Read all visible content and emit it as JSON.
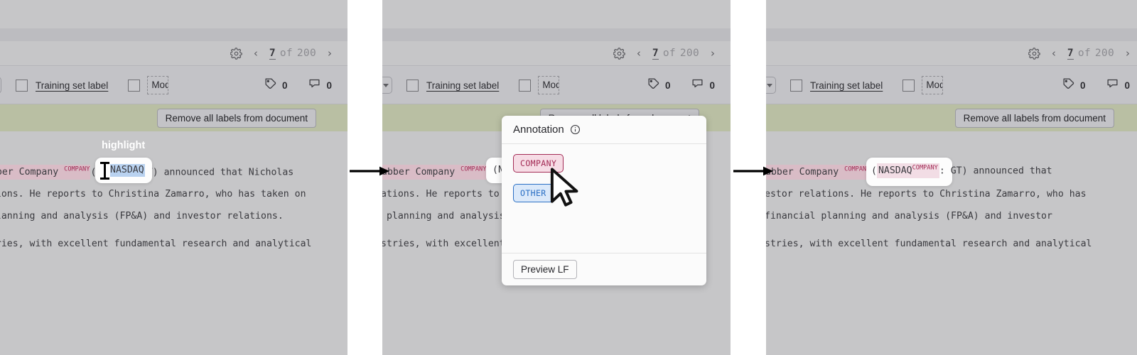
{
  "app": {
    "panel_count": 3
  },
  "toolbar": {
    "training_set_label": "Training set label",
    "mod_chip": "Mod",
    "tag_count": "0",
    "comment_count": "0",
    "gear_icon": "gear-icon",
    "tag_icon": "tag-icon",
    "comment_icon": "comment-icon",
    "chevron_icon": "chevron-down-icon"
  },
  "pager": {
    "prev": "‹",
    "next": "›",
    "current": "7",
    "of": "of",
    "total": "200"
  },
  "greenbar": {
    "remove_all_label": "Remove all labels from document"
  },
  "document": {
    "line1_pre": "ubber Company ",
    "line1_sup": "COMPANY",
    "line1_mid_p1": "(",
    "line1_nasdaq": "NASDAQ",
    "line1_post_p1": ": GT) announced that Nicholas",
    "line2_p1": "ations. He reports to Christina Zamarro, who has taken on",
    "line3_p1": " planning and analysis (FP&A) and investor relations.",
    "line4_p1": "stries, with excellent fundamental research and analytical",
    "line2_p2": "ations. He reports to Chr",
    "line3_p2": " planning and analysis (F",
    "line4_p2": "stries, with excellent fu",
    "line1_p2_pre": "ubber Company ",
    "line1_p2_paren": "(NAS",
    "line1_p3_pre": "ubber Company ",
    "line1_p3_paren": "(",
    "line1_p3_nasdaq": "NASDAQ",
    "line1_p3_tail": ": GT) announced that",
    "line2_p3": "estor relations. He reports to Christina Zamarro, who has",
    "line3_p3": "financial planning and analysis (FP&A) and investor",
    "line4_p3": "stries, with excellent fundamental research and analytical"
  },
  "panel1": {
    "highlight_caption": "highlight"
  },
  "annotation_popup": {
    "title": "Annotation",
    "info_icon": "info-icon",
    "tags": [
      {
        "label": "COMPANY",
        "color": "#a32b55",
        "bg": "#f6dce5"
      },
      {
        "label": "OTHER",
        "color": "#2a6fc4",
        "bg": "#dbe9fa"
      }
    ],
    "preview_button": "Preview LF"
  },
  "colors": {
    "panel_bg": "#c6c6c8",
    "green_bar": "#b9bfa3",
    "company_highlight": "#d9bcc6",
    "selection_blue": "#b9d2f0",
    "company_accent": "#a32b55",
    "other_accent": "#2a6fc4"
  }
}
